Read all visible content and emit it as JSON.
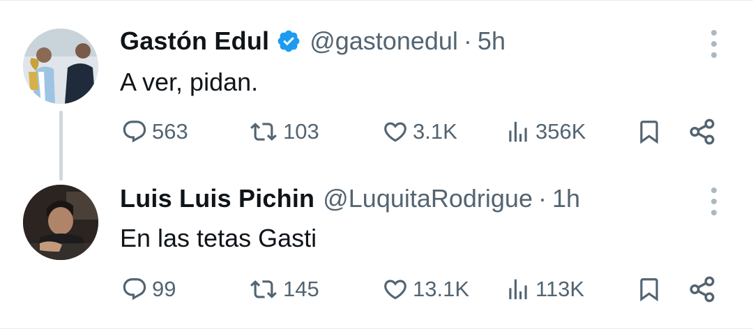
{
  "tweets": [
    {
      "display_name": "Gastón Edul",
      "handle": "@gastonedul",
      "separator": "·",
      "time": "5h",
      "verified": true,
      "text": "A ver, pidan.",
      "actions": {
        "replies": "563",
        "retweets": "103",
        "likes": "3.1K",
        "views": "356K"
      }
    },
    {
      "display_name": "Luis Luis Pichin",
      "handle": "@LuquitaRodrigue",
      "separator": "·",
      "time": "1h",
      "verified": false,
      "text": "En las tetas Gasti",
      "actions": {
        "replies": "99",
        "retweets": "145",
        "likes": "13.1K",
        "views": "113K"
      }
    }
  ],
  "colors": {
    "text_primary": "#0f1419",
    "text_secondary": "#536471",
    "verified_badge": "#1d9bf0",
    "thread_line": "#cfd9de"
  },
  "icons": [
    "reply-icon",
    "retweet-icon",
    "like-icon",
    "views-icon",
    "bookmark-icon",
    "share-icon",
    "more-icon",
    "verified-badge-icon"
  ]
}
